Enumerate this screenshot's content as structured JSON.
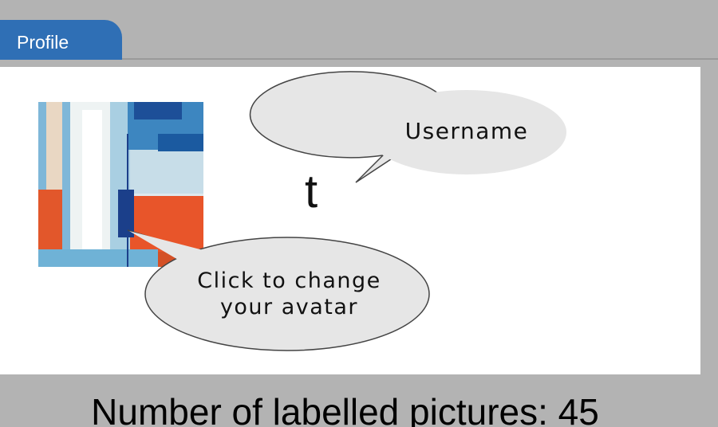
{
  "tabs": [
    {
      "label": "Profile"
    }
  ],
  "profile": {
    "username": "t",
    "avatar_alt": "Abstract painting avatar",
    "username_hint": "Username",
    "avatar_hint_line1": "Click to change",
    "avatar_hint_line2": "your avatar"
  },
  "stats": {
    "labelled_pictures_text": "Number of labelled pictures: 45",
    "labelled_pictures": 45
  },
  "colors": {
    "tab": "#2f6fb5",
    "background": "#b3b3b3",
    "panel": "#ffffff",
    "bubble": "#e6e6e6"
  }
}
